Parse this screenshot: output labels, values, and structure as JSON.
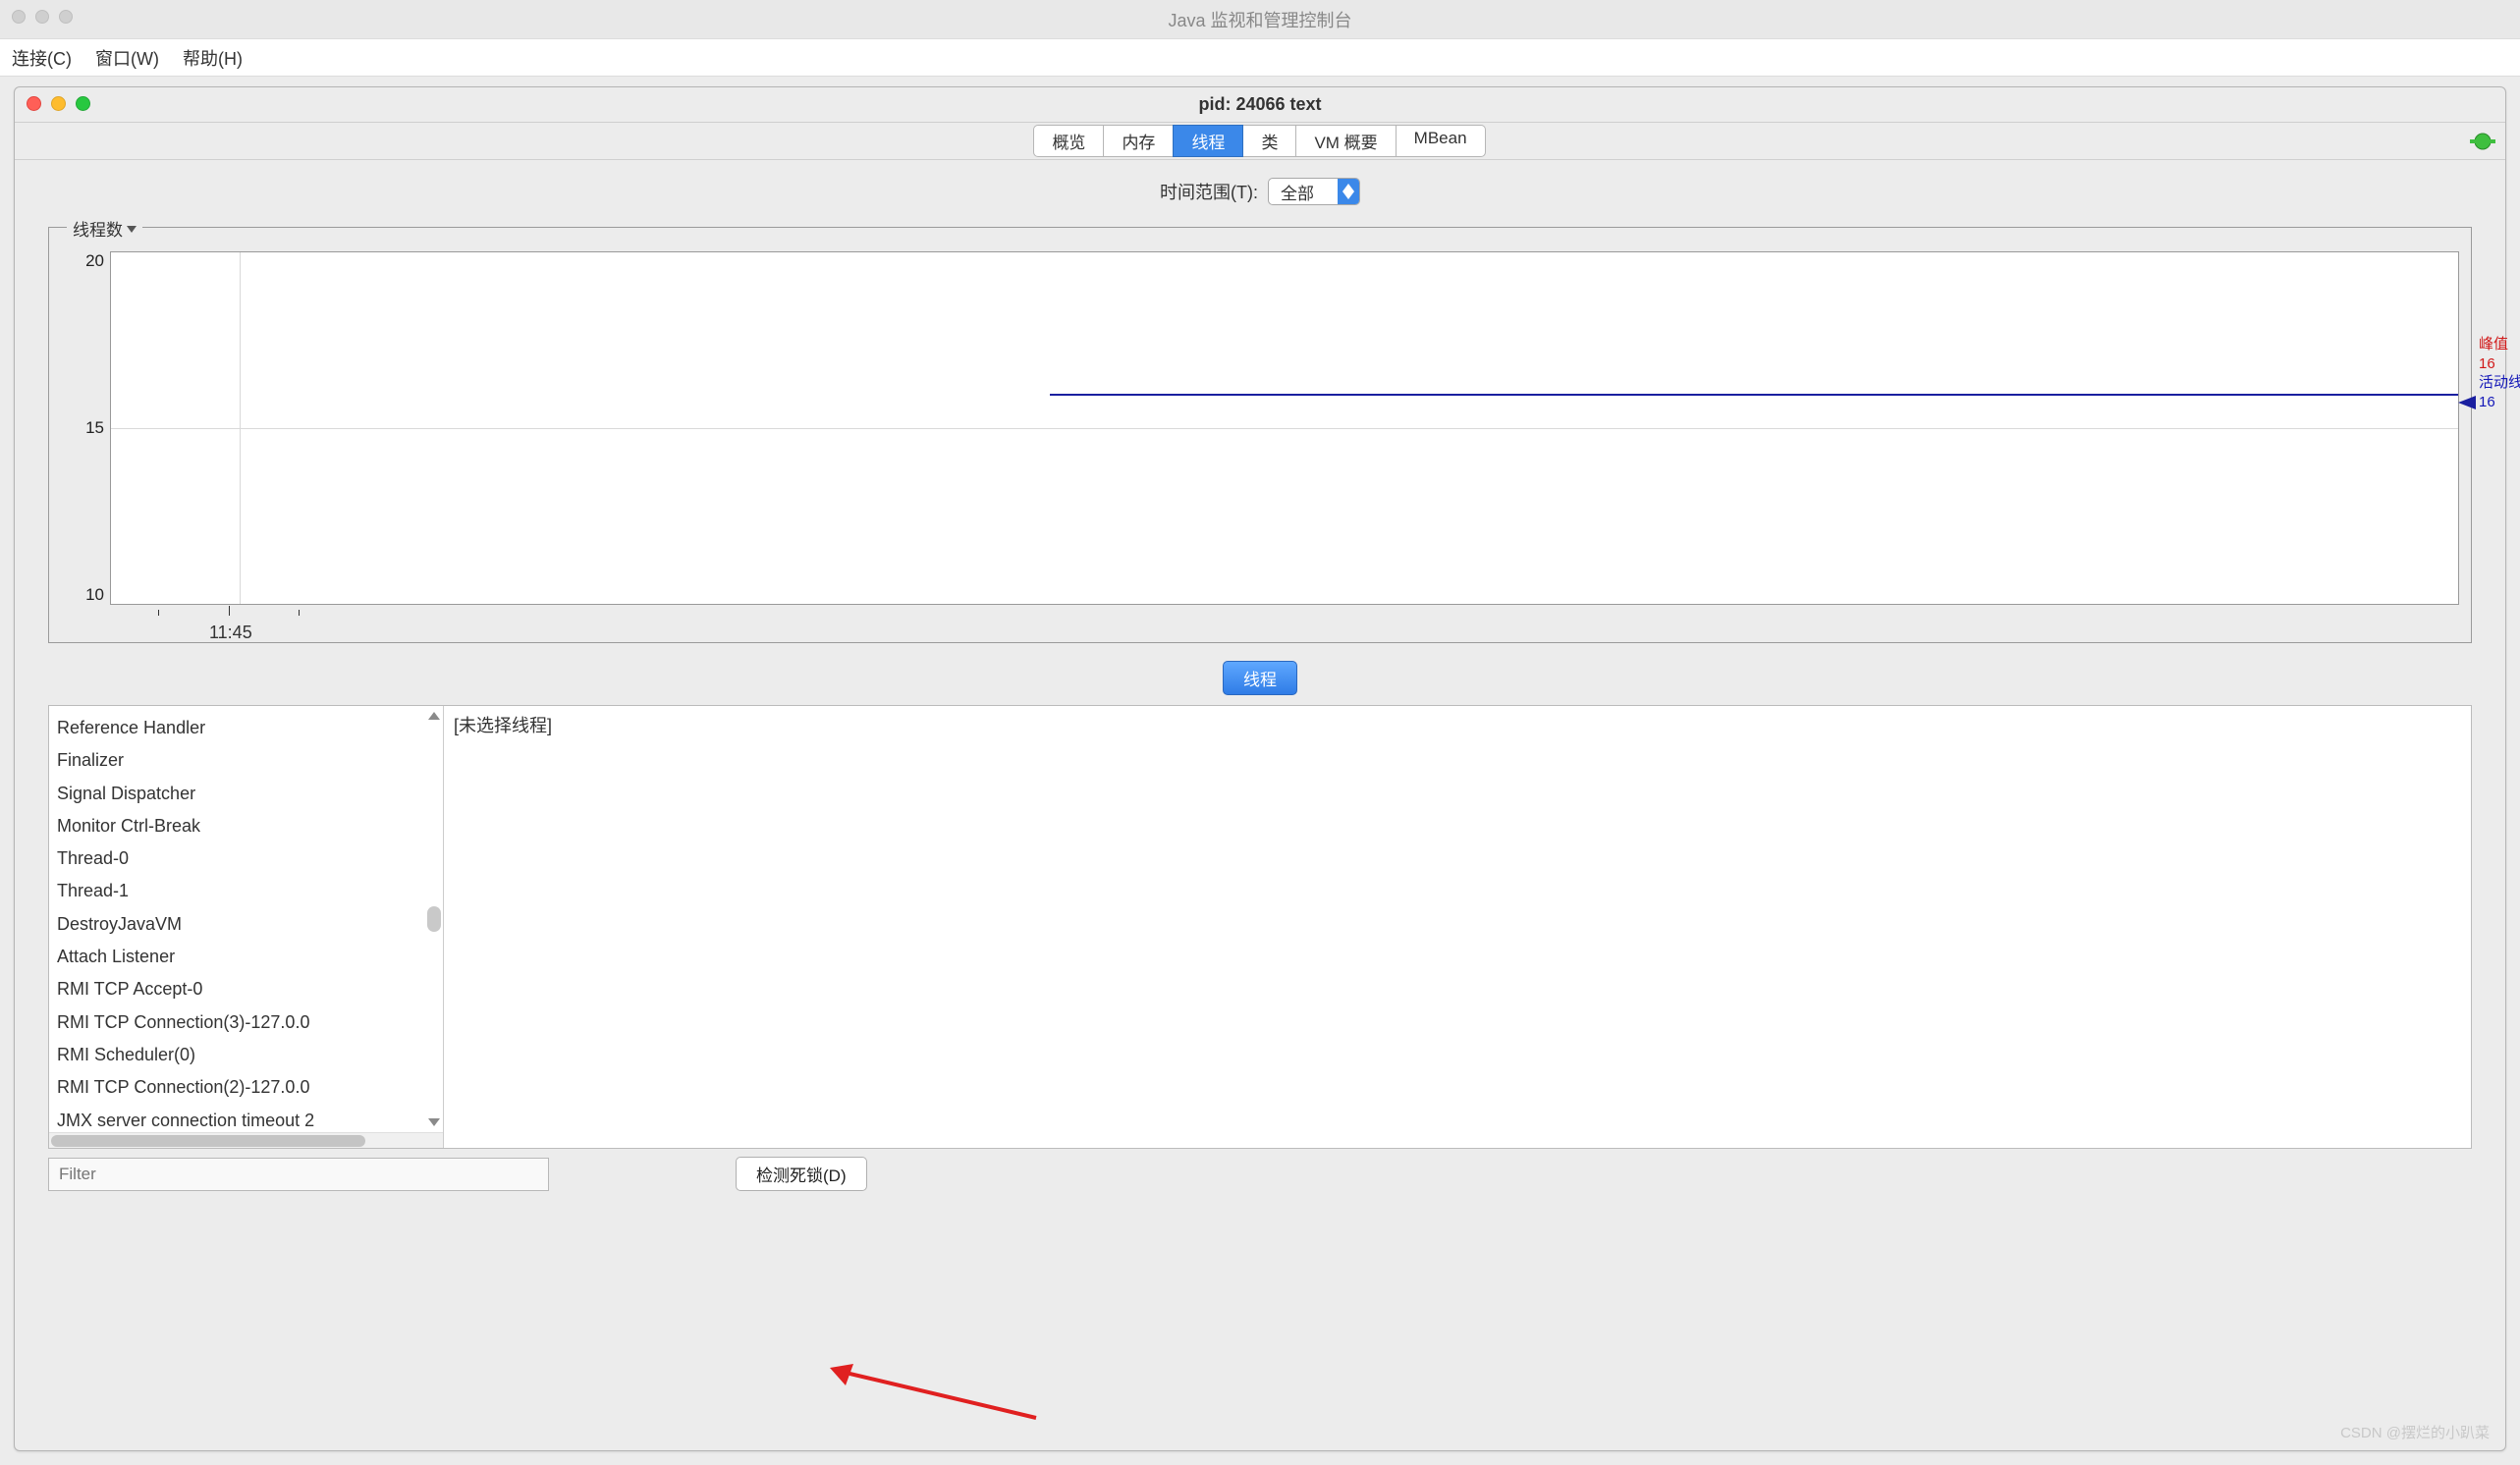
{
  "outer_title": "Java 监视和管理控制台",
  "menubar": {
    "items": [
      "连接(C)",
      "窗口(W)",
      "帮助(H)"
    ]
  },
  "inner_title": "pid: 24066 text",
  "tabs": [
    {
      "label": "概览",
      "active": false
    },
    {
      "label": "内存",
      "active": false
    },
    {
      "label": "线程",
      "active": true
    },
    {
      "label": "类",
      "active": false
    },
    {
      "label": "VM 概要",
      "active": false
    },
    {
      "label": "MBean",
      "active": false
    }
  ],
  "time_range": {
    "label": "时间范围(T):",
    "value": "全部"
  },
  "chart": {
    "group_label": "线程数",
    "y_ticks": [
      "20",
      "15",
      "10"
    ],
    "x_tick": "11:45",
    "legend": {
      "peak_label": "峰值",
      "peak_value": "16",
      "live_label": "活动线程",
      "live_value": "16"
    }
  },
  "chart_data": {
    "type": "line",
    "title": "线程数",
    "xlabel": "",
    "ylabel": "",
    "ylim": [
      10,
      20
    ],
    "x_ticks": [
      "11:45"
    ],
    "series": [
      {
        "name": "活动线程",
        "values": [
          16,
          16,
          16,
          16,
          16
        ]
      }
    ],
    "annotations": {
      "峰值": 16,
      "活动线程": 16
    }
  },
  "threads_button": "线程",
  "thread_list": [
    "Reference Handler",
    "Finalizer",
    "Signal Dispatcher",
    "Monitor Ctrl-Break",
    "Thread-0",
    "Thread-1",
    "DestroyJavaVM",
    "Attach Listener",
    "RMI TCP Accept-0",
    "RMI TCP Connection(3)-127.0.0",
    "RMI Scheduler(0)",
    "RMI TCP Connection(2)-127.0.0",
    "JMX server connection timeout 2"
  ],
  "thread_detail_placeholder": "[未选择线程]",
  "filter_placeholder": "Filter",
  "deadlock_button": "检测死锁(D)",
  "watermark": "CSDN @摆烂的小趴菜"
}
